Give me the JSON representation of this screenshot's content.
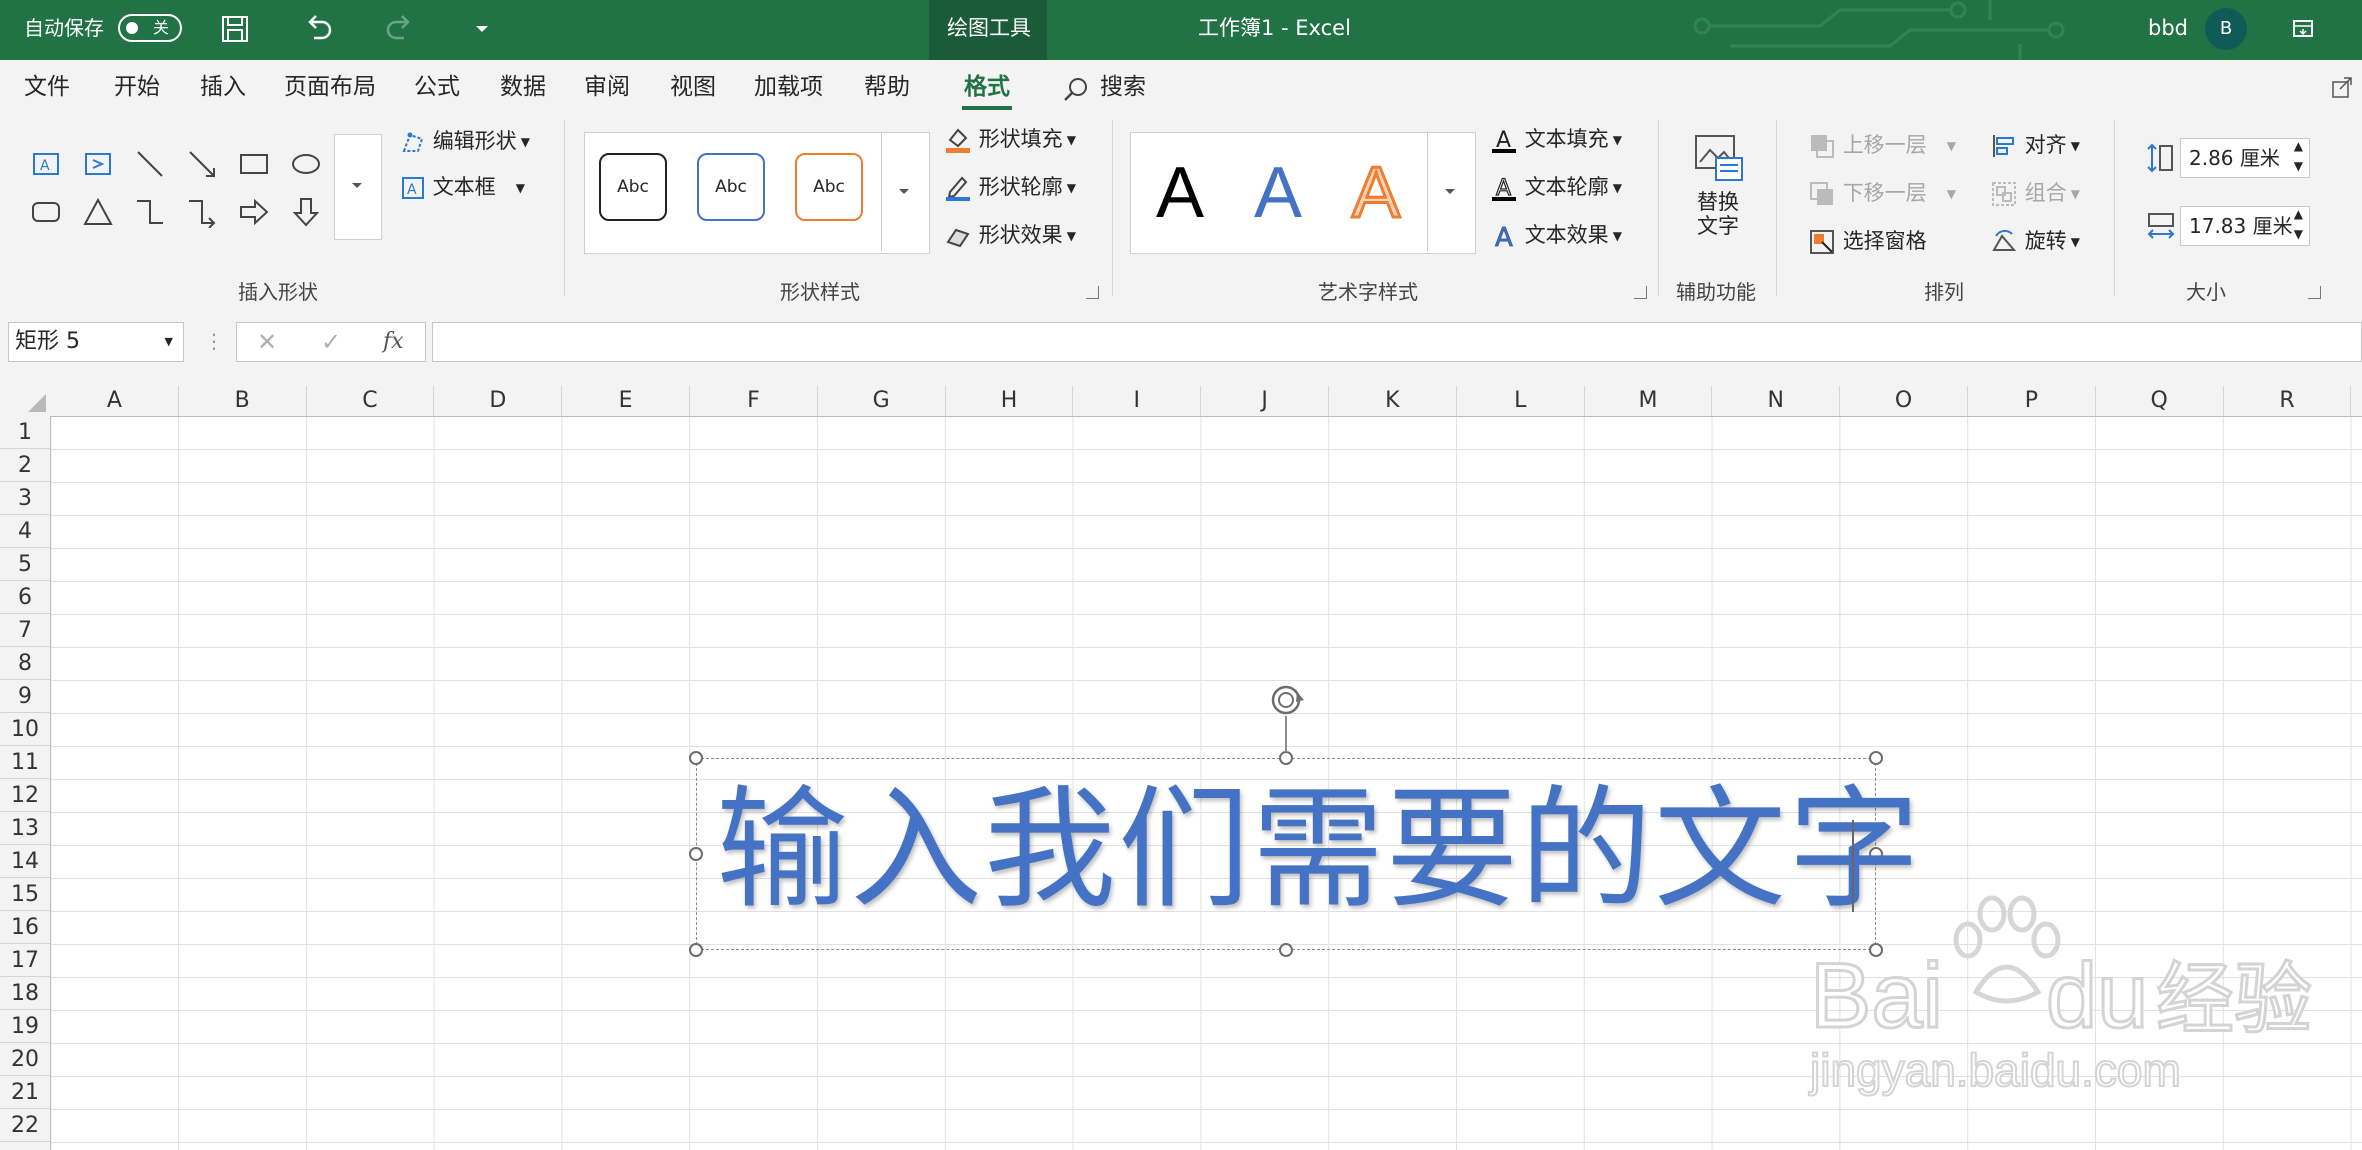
{
  "titlebar": {
    "autosave_label": "自动保存",
    "autosave_state": "关",
    "context_tab": "绘图工具",
    "title": "工作簿1  -  Excel",
    "user": "bbd",
    "avatar_letter": "B"
  },
  "tabs": [
    {
      "label": "文件"
    },
    {
      "label": "开始"
    },
    {
      "label": "插入"
    },
    {
      "label": "页面布局"
    },
    {
      "label": "公式"
    },
    {
      "label": "数据"
    },
    {
      "label": "审阅"
    },
    {
      "label": "视图"
    },
    {
      "label": "加载项"
    },
    {
      "label": "帮助"
    },
    {
      "label": "格式",
      "active": true
    }
  ],
  "search_label": "搜索",
  "ribbon": {
    "insert_shapes": {
      "label": "插入形状",
      "edit_shape": "编辑形状",
      "text_box": "文本框"
    },
    "shape_styles": {
      "label": "形状样式",
      "swatch_text": "Abc",
      "fill": "形状填充",
      "outline": "形状轮廓",
      "effects": "形状效果"
    },
    "wordart_styles": {
      "label": "艺术字样式",
      "sample": "A",
      "text_fill": "文本填充",
      "text_outline": "文本轮廓",
      "text_effects": "文本效果"
    },
    "accessibility": {
      "label": "辅助功能",
      "alt_text_line1": "替换",
      "alt_text_line2": "文字"
    },
    "arrange": {
      "label": "排列",
      "bring_forward": "上移一层",
      "send_backward": "下移一层",
      "selection_pane": "选择窗格",
      "align": "对齐",
      "group": "组合",
      "rotate": "旋转"
    },
    "size": {
      "label": "大小",
      "height": "2.86 厘米",
      "width": "17.83 厘米"
    }
  },
  "formula_bar": {
    "name_box": "矩形 5",
    "fx": "fx",
    "value": ""
  },
  "columns": [
    "A",
    "B",
    "C",
    "D",
    "E",
    "F",
    "G",
    "H",
    "I",
    "J",
    "K",
    "L",
    "M",
    "N",
    "O",
    "P",
    "Q",
    "R"
  ],
  "rows": [
    "1",
    "2",
    "3",
    "4",
    "5",
    "6",
    "7",
    "8",
    "9",
    "10",
    "11",
    "12",
    "13",
    "14",
    "15",
    "16",
    "17",
    "18",
    "19",
    "20",
    "21",
    "22"
  ],
  "wordart_text": "输入我们需要的文字",
  "watermark": {
    "brand": "Bai",
    "brand2": "du",
    "cn": "经验",
    "url": "jingyan.baidu.com"
  },
  "colors": {
    "excel_green": "#217346",
    "wordart_blue": "#4472c4",
    "orange": "#ed7d31"
  }
}
